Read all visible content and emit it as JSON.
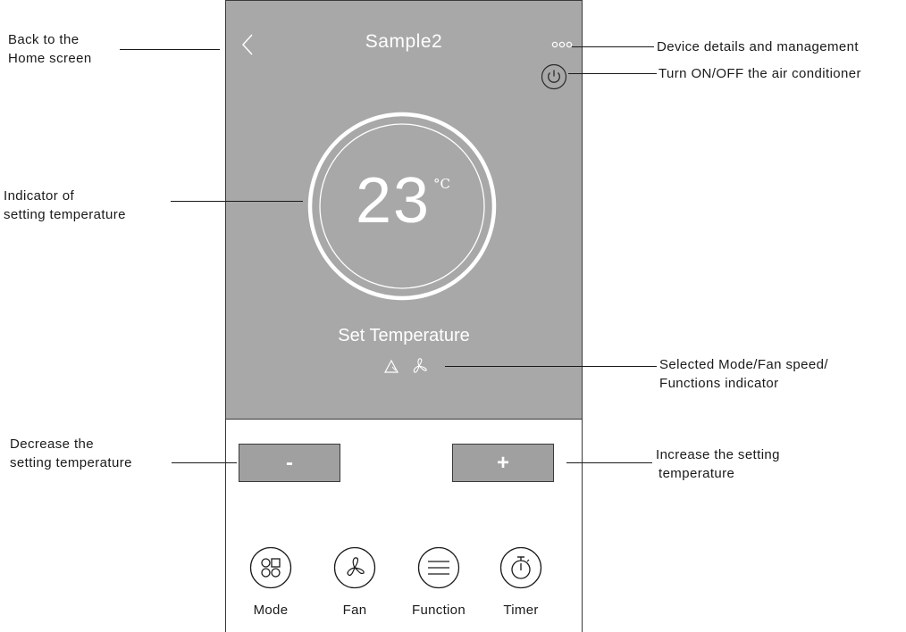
{
  "app": {
    "title": "Sample2",
    "temperature": "23",
    "unit": "°C",
    "set_label": "Set Temperature",
    "minus_label": "-",
    "plus_label": "+",
    "controls": [
      {
        "label": "Mode",
        "icon": "mode-grid-icon"
      },
      {
        "label": "Fan",
        "icon": "fan-icon"
      },
      {
        "label": "Function",
        "icon": "function-list-icon"
      },
      {
        "label": "Timer",
        "icon": "timer-icon"
      }
    ],
    "indicators": [
      "mode-triangle-icon",
      "fan-speed-icon"
    ],
    "colors": {
      "hero": "#a8a8a8",
      "button": "#a0a0a0",
      "foreground": "#ffffff",
      "outline": "#3a3a3a"
    }
  },
  "annotations": {
    "back": {
      "line1": "Back to the",
      "line2": "Home screen"
    },
    "indicator": {
      "line1": "Indicator of",
      "line2": "setting temperature"
    },
    "decrease": {
      "line1": "Decrease the",
      "line2": "setting temperature"
    },
    "details": "Device details and management",
    "power": "Turn ON/OFF the air conditioner",
    "mode_fan": {
      "line1": "Selected Mode/Fan speed/",
      "line2": "Functions indicator"
    },
    "increase": {
      "line1": "Increase the setting",
      "line2": "temperature"
    }
  }
}
